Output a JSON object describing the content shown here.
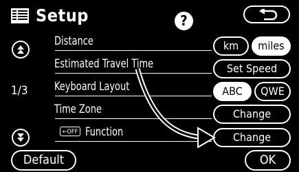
{
  "header": {
    "title": "Setup",
    "help_label": "?"
  },
  "page_indicator": "1/3",
  "rows": [
    {
      "label": "Distance"
    },
    {
      "label": "Estimated Travel Time"
    },
    {
      "label": "Keyboard Layout"
    },
    {
      "label": "Time Zone"
    },
    {
      "label": "Function",
      "badge": "←OFF"
    }
  ],
  "controls": {
    "km": "km",
    "miles": "miles",
    "set_speed": "Set Speed",
    "abc": "ABC",
    "qwe": "QWE",
    "change_time_zone": "Change",
    "change_function": "Change"
  },
  "footer": {
    "default": "Default",
    "ok": "OK"
  }
}
